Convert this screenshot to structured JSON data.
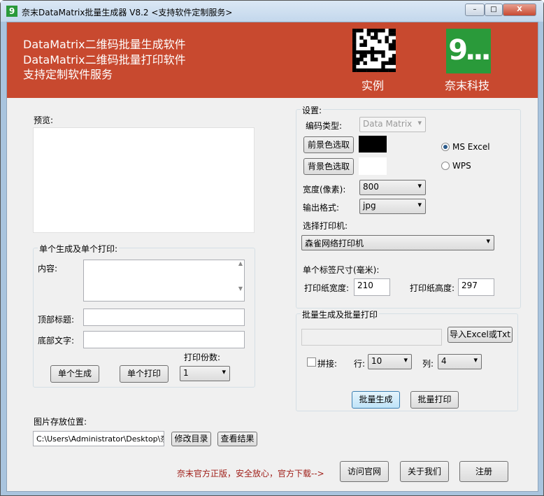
{
  "window": {
    "title": "奈末DataMatrix批量生成器 V8.2  <支持软件定制服务>",
    "min": "–",
    "max": "□",
    "close": "X"
  },
  "banner": {
    "lines": [
      "DataMatrix二维码批量生成软件",
      "DataMatrix二维码批量打印软件",
      "支持定制软件服务"
    ],
    "example_label": "实例",
    "brand_label": "奈末科技",
    "brand_logo_text": "9...",
    "accent": "#c8492f"
  },
  "preview": {
    "label": "预览:"
  },
  "single": {
    "group_label": "单个生成及单个打印:",
    "content_label": "内容:",
    "content_value": "",
    "top_title_label": "顶部标题:",
    "top_title_value": "",
    "bottom_text_label": "底部文字:",
    "bottom_text_value": "",
    "copies_label": "打印份数:",
    "copies_value": "1",
    "generate_btn": "单个生成",
    "print_btn": "单个打印"
  },
  "settings": {
    "group_label": "设置:",
    "code_type_label": "编码类型:",
    "code_type_value": "Data Matrix",
    "fg_btn": "前景色选取",
    "bg_btn": "背景色选取",
    "fg_color": "#000000",
    "bg_color": "#ffffff",
    "radio_excel": "MS  Excel",
    "radio_wps": "WPS",
    "radio_selected": "excel",
    "width_label": "宽度(像素):",
    "width_value": "800",
    "format_label": "输出格式:",
    "format_value": "jpg",
    "printer_label": "选择打印机:",
    "printer_value": "森雀网络打印机",
    "label_size_label": "单个标签尺寸(毫米):",
    "paper_width_label": "打印纸宽度:",
    "paper_width_value": "210",
    "paper_height_label": "打印纸高度:",
    "paper_height_value": "297"
  },
  "batch": {
    "group_label": "批量生成及批量打印",
    "file_value": "",
    "import_btn": "导入Excel或Txt",
    "concat_label": "拼接:",
    "row_label": "行:",
    "row_value": "10",
    "col_label": "列:",
    "col_value": "4",
    "generate_btn": "批量生成",
    "print_btn": "批量打印"
  },
  "storage": {
    "label": "图片存放位置:",
    "path": "C:\\Users\\Administrator\\Desktop\\奈",
    "change_btn": "修改目录",
    "view_btn": "查看结果"
  },
  "footer": {
    "notice": "奈末官方正版，安全放心，官方下载-->",
    "site_btn": "访问官网",
    "about_btn": "关于我们",
    "register_btn": "注册"
  }
}
